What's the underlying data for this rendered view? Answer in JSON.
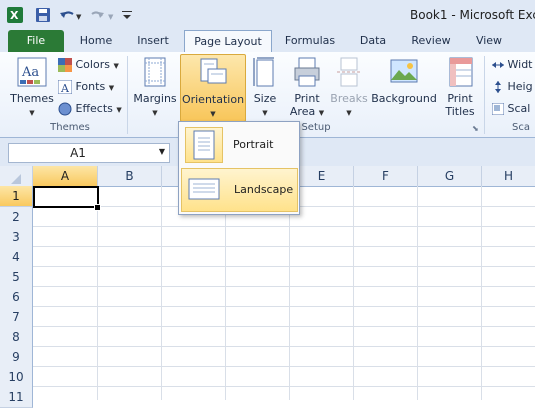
{
  "app": {
    "window_title": "Book1 - Microsoft Exce"
  },
  "tabs": [
    {
      "label": "File"
    },
    {
      "label": "Home"
    },
    {
      "label": "Insert"
    },
    {
      "label": "Page Layout"
    },
    {
      "label": "Formulas"
    },
    {
      "label": "Data"
    },
    {
      "label": "Review"
    },
    {
      "label": "View"
    }
  ],
  "ribbon": {
    "themes": {
      "label": "Themes",
      "colors": "Colors",
      "fonts": "Fonts",
      "effects": "Effects",
      "group": "Themes"
    },
    "page_setup": {
      "margins": "Margins",
      "orientation": "Orientation",
      "size": "Size",
      "print_area_1": "Print",
      "print_area_2": "Area",
      "breaks": "Breaks",
      "background": "Background",
      "print_titles_1": "Print",
      "print_titles_2": "Titles",
      "group": "Setup"
    },
    "scale": {
      "width": "Widt",
      "height": "Heig",
      "scale": "Scal",
      "group": "Sca"
    }
  },
  "formula_bar": {
    "name_box": "A1"
  },
  "grid": {
    "columns": [
      "A",
      "B",
      "C",
      "D",
      "E",
      "F",
      "G",
      "H"
    ],
    "rows": [
      "1",
      "2",
      "3",
      "4",
      "5",
      "6",
      "7",
      "8",
      "9",
      "10",
      "11"
    ],
    "selected_cell": "A1"
  },
  "orientation_menu": {
    "items": [
      {
        "label": "Portrait"
      },
      {
        "label": "Landscape"
      }
    ],
    "highlighted": "Landscape"
  }
}
